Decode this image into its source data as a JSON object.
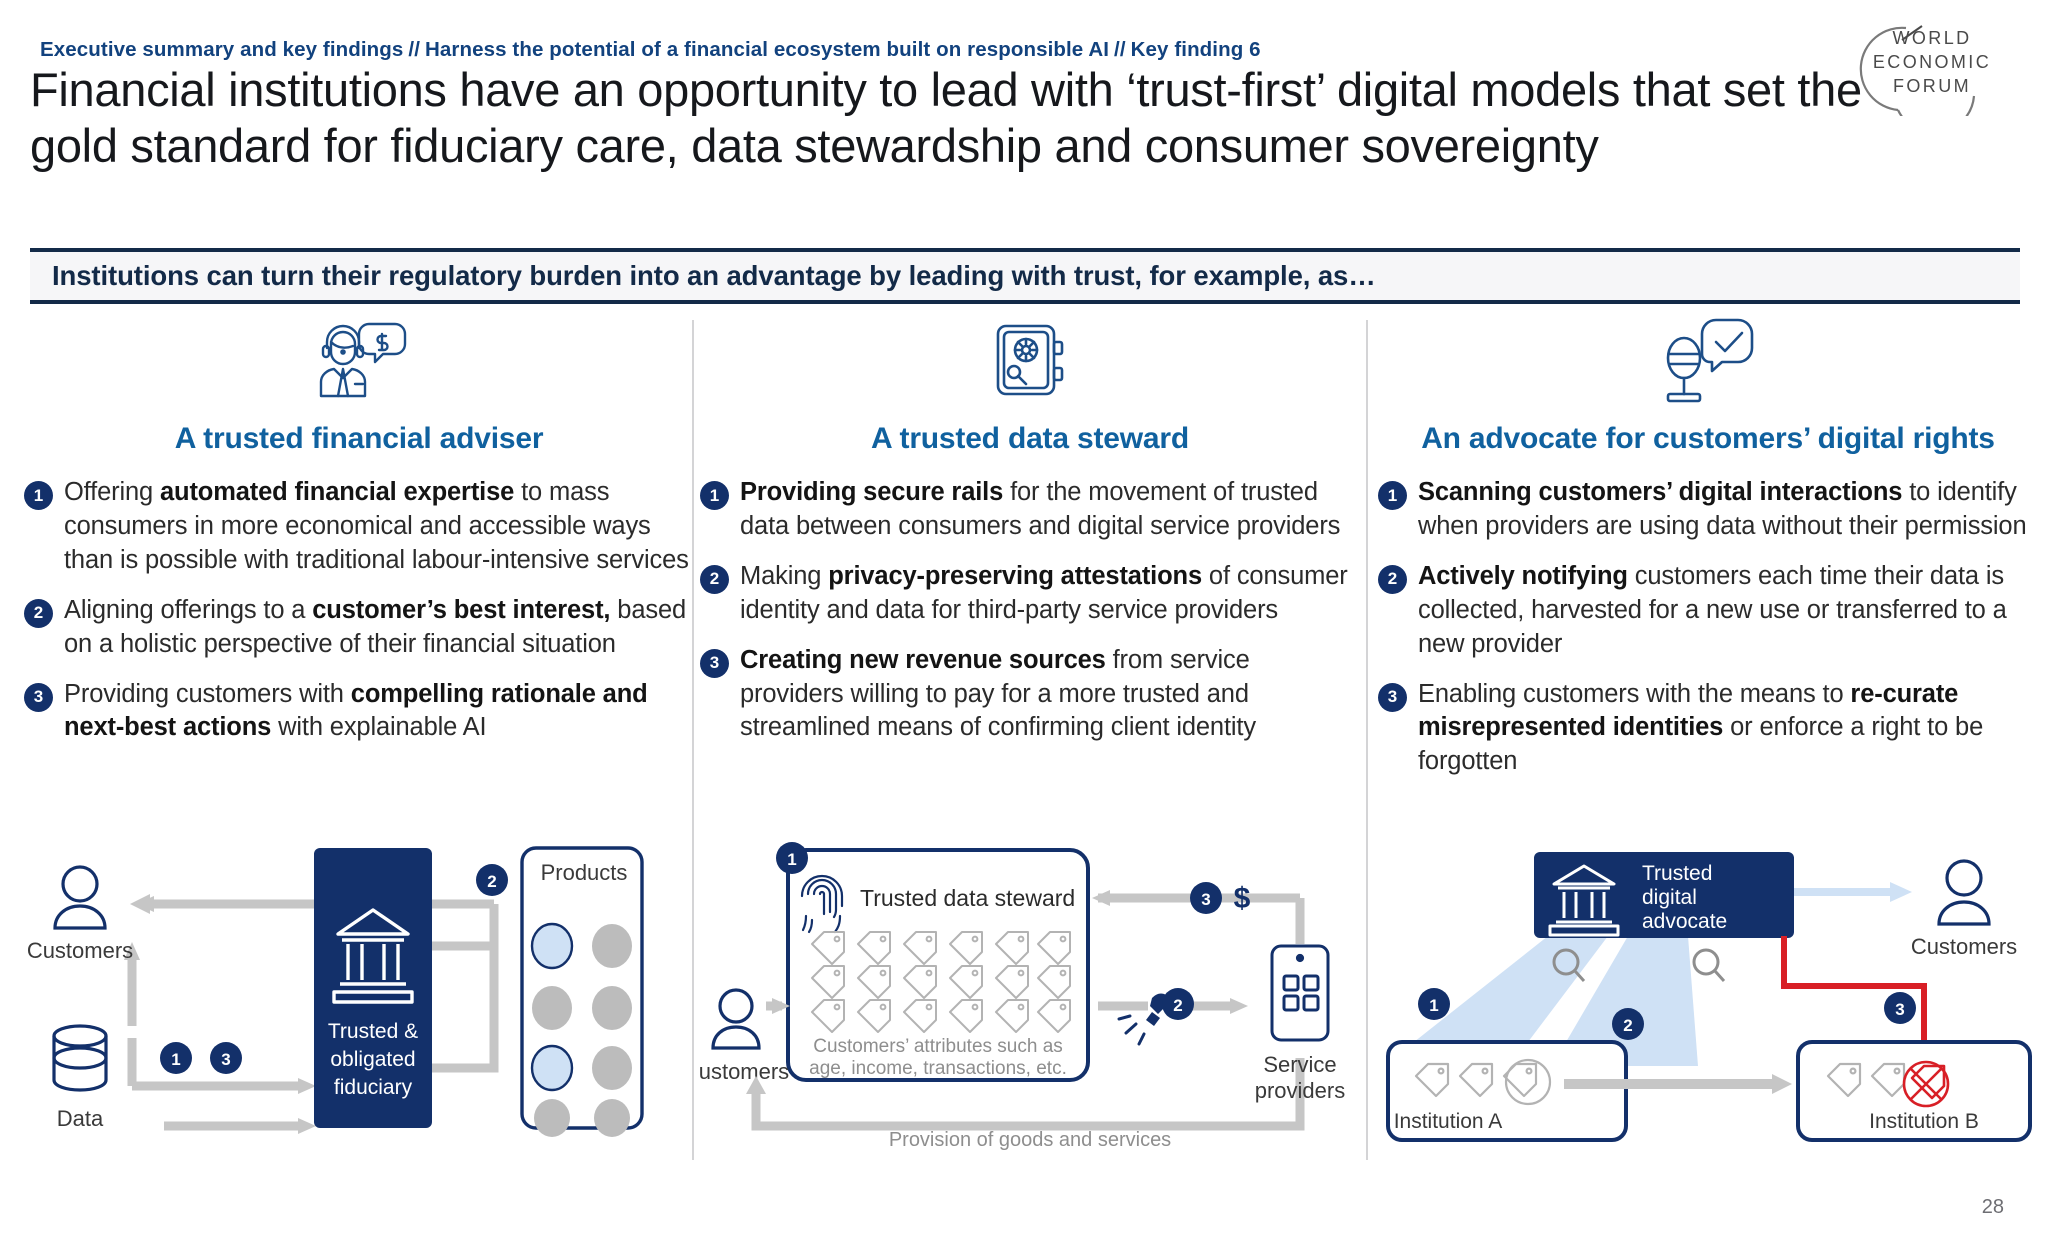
{
  "header": {
    "breadcrumb": [
      "Executive summary and key findings",
      "Harness the potential of a financial ecosystem built on responsible AI",
      "Key finding 6"
    ],
    "breadcrumb_separator": "//",
    "headline": "Financial institutions have an opportunity to lead with ‘trust-first’ digital models that set the gold standard for fiduciary care, data stewardship and consumer sovereignty",
    "logo": {
      "line1": "WORLD",
      "line2": "ECONOMIC",
      "line3": "FORUM",
      "name": "world-economic-forum-logo"
    }
  },
  "band": {
    "text": "Institutions can turn their regulatory burden into an advantage by leading with trust, for example, as…"
  },
  "colors": {
    "navy": "#13306a",
    "navy_dark": "#132a48",
    "heading_blue": "#10619f",
    "breadcrumb_blue": "#12427e",
    "grey_arrow": "#c6c6c6",
    "light_blue": "#cfe1f5",
    "red": "#d81f26",
    "band_bg": "#f6f6f8"
  },
  "columns": [
    {
      "icon": "adviser-headset-dollar-icon",
      "title": "A trusted financial adviser",
      "points": [
        {
          "n": "1",
          "html": "Offering <b>automated financial expertise</b> to mass consumers in more economical and accessible ways than is possible with traditional labour-intensive services"
        },
        {
          "n": "2",
          "html": "Aligning offerings to a <b>customer’s best interest,</b> based on a holistic perspective of their financial situation"
        },
        {
          "n": "3",
          "html": "Providing customers with <b>compelling rationale and next-best actions</b> with explainable AI"
        }
      ],
      "diagram": {
        "name": "trusted-fiduciary-diagram",
        "customers_label": "Customers",
        "data_label": "Data",
        "center_label": "Trusted & obligated fiduciary",
        "center_label_lines": [
          "Trusted &",
          "obligated",
          "fiduciary"
        ],
        "products_label": "Products",
        "markers": [
          "1",
          "3",
          "2"
        ]
      }
    },
    {
      "icon": "safe-vault-icon",
      "title": "A trusted data steward",
      "points": [
        {
          "n": "1",
          "html": "<b>Providing secure rails</b> for the movement of trusted data between consumers and digital service providers"
        },
        {
          "n": "2",
          "html": "Making <b>privacy-preserving attestations</b> of consumer identity and data for third-party service providers"
        },
        {
          "n": "3",
          "html": "<b>Creating new revenue sources</b> from service providers willing to pay for a more trusted and streamlined means of confirming client identity"
        }
      ],
      "diagram": {
        "name": "trusted-data-steward-diagram",
        "customers_label": "Customers",
        "steward_label": "Trusted data steward",
        "attributes_line1": "Customers’ attributes such as",
        "attributes_line2": "age, income, transactions, etc.",
        "providers_line1": "Service",
        "providers_line2": "providers",
        "flow_label": "Provision of goods and services",
        "dollar": "$",
        "markers": [
          "1",
          "2",
          "3"
        ]
      }
    },
    {
      "icon": "microphone-check-icon",
      "title": "An advocate for customers’ digital rights",
      "points": [
        {
          "n": "1",
          "html": "<b>Scanning customers’ digital interactions</b> to identify when providers are using data without their permission"
        },
        {
          "n": "2",
          "html": "<b>Actively notifying</b> customers each time their data is collected, harvested for a new use or transferred to a new provider"
        },
        {
          "n": "3",
          "html": "Enabling customers with the means to <b>re-curate misrepresented identities</b> or enforce a right to be forgotten"
        }
      ],
      "diagram": {
        "name": "digital-advocate-diagram",
        "advocate_lines": [
          "Trusted",
          "digital",
          "advocate"
        ],
        "customers_label": "Customers",
        "institution_a_label": "Institution A",
        "institution_b_label": "Institution B",
        "markers": [
          "1",
          "2",
          "3"
        ]
      }
    }
  ],
  "footer": {
    "page_number": "28"
  }
}
